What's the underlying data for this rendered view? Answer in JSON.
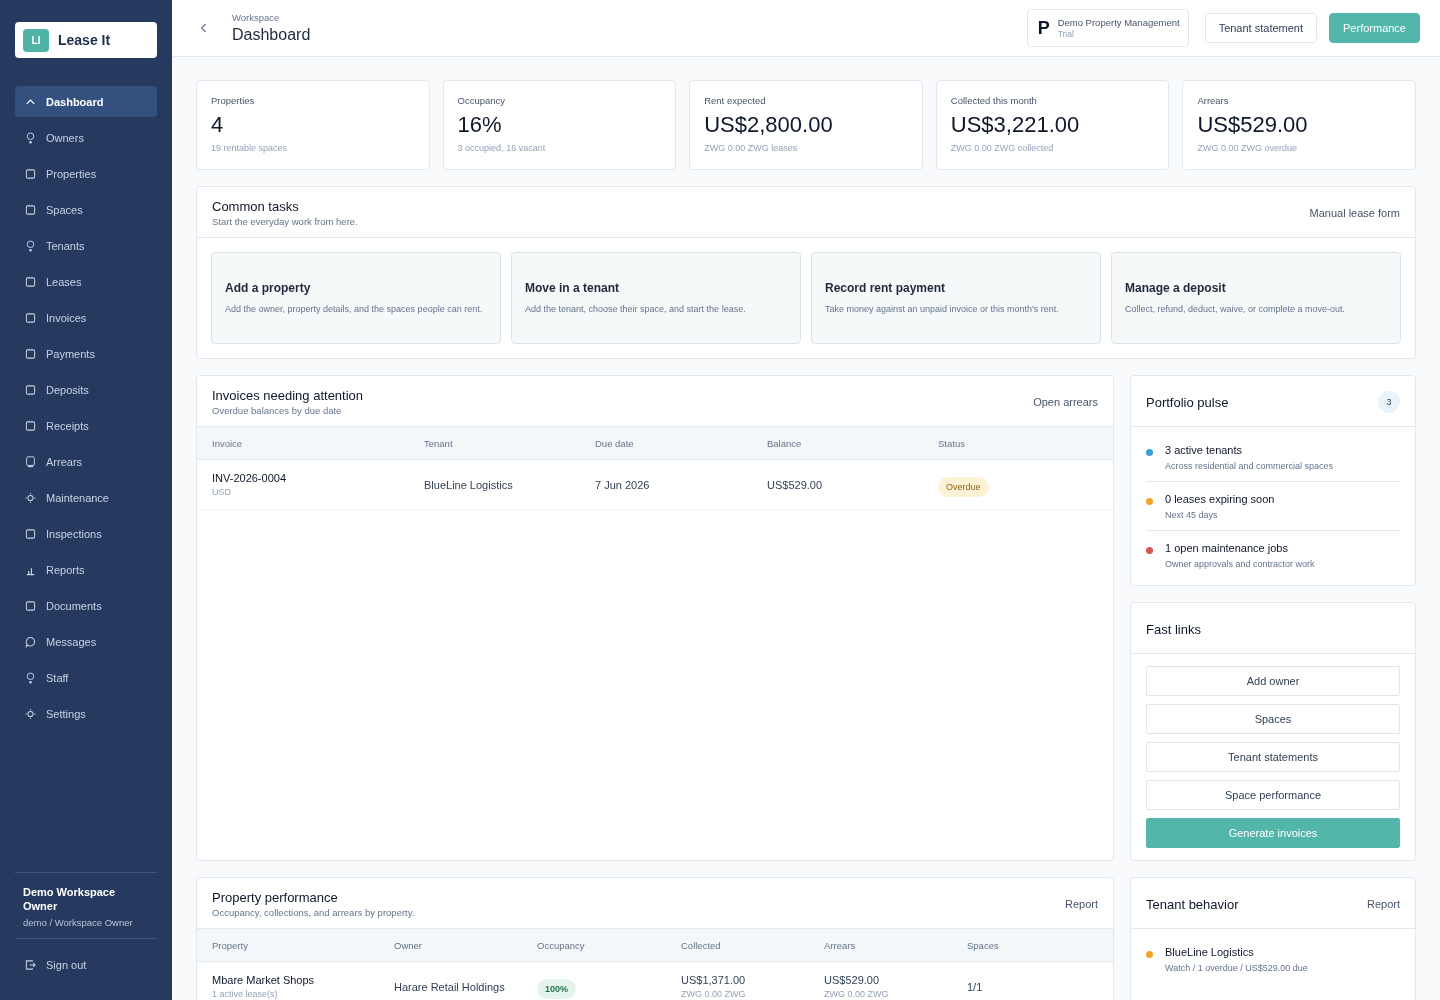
{
  "brand": {
    "logo": "LI",
    "name": "Lease It"
  },
  "nav": [
    {
      "label": "Dashboard",
      "selected": true
    },
    {
      "label": "Owners",
      "selected": false
    },
    {
      "label": "Properties",
      "selected": false
    },
    {
      "label": "Spaces",
      "selected": false
    },
    {
      "label": "Tenants",
      "selected": false
    },
    {
      "label": "Leases",
      "selected": false
    },
    {
      "label": "Invoices",
      "selected": false
    },
    {
      "label": "Payments",
      "selected": false
    },
    {
      "label": "Deposits",
      "selected": false
    },
    {
      "label": "Receipts",
      "selected": false
    },
    {
      "label": "Arrears",
      "selected": false
    },
    {
      "label": "Maintenance",
      "selected": false
    },
    {
      "label": "Inspections",
      "selected": false
    },
    {
      "label": "Reports",
      "selected": false
    },
    {
      "label": "Documents",
      "selected": false
    },
    {
      "label": "Messages",
      "selected": false
    },
    {
      "label": "Staff",
      "selected": false
    },
    {
      "label": "Settings",
      "selected": false
    }
  ],
  "user": {
    "name": "Demo Workspace Owner",
    "role": "demo / Workspace Owner"
  },
  "sign_out": "Sign out",
  "header": {
    "breadcrumb": "Workspace",
    "title": "Dashboard",
    "org_initial": "P",
    "org_name": "Demo Property Management",
    "org_plan": "Trial",
    "buttons": [
      "Tenant statement",
      "Performance"
    ]
  },
  "stats": [
    {
      "label": "Properties",
      "value": "4",
      "note": "19 rentable spaces"
    },
    {
      "label": "Occupancy",
      "value": "16%",
      "note": "3 occupied, 16 vacant"
    },
    {
      "label": "Rent expected",
      "value": "US$2,800.00",
      "note": "ZWG 0.00 ZWG leases"
    },
    {
      "label": "Collected this month",
      "value": "US$3,221.00",
      "note": "ZWG 0.00 ZWG collected"
    },
    {
      "label": "Arrears",
      "value": "US$529.00",
      "note": "ZWG 0.00 ZWG overdue"
    }
  ],
  "common_tasks": {
    "title": "Common tasks",
    "subtitle": "Start the everyday work from here.",
    "link": "Manual lease form",
    "tasks": [
      {
        "title": "Add a property",
        "text": "Add the owner, property details, and the spaces people can rent."
      },
      {
        "title": "Move in a tenant",
        "text": "Add the tenant, choose their space, and start the lease."
      },
      {
        "title": "Record rent payment",
        "text": "Take money against an unpaid invoice or this month's rent."
      },
      {
        "title": "Manage a deposit",
        "text": "Collect, refund, deduct, waive, or complete a move-out."
      }
    ]
  },
  "invoices": {
    "title": "Invoices needing attention",
    "subtitle": "Overdue balances by due date",
    "link": "Open arrears",
    "columns": [
      "Invoice",
      "Tenant",
      "Due date",
      "Balance",
      "Status"
    ],
    "rows": [
      {
        "invoice": "INV-2026-0004",
        "currency": "USD",
        "tenant": "BlueLine Logistics",
        "due": "7 Jun 2026",
        "balance": "US$529.00",
        "status": "Overdue"
      }
    ]
  },
  "portfolio_pulse": {
    "title": "Portfolio pulse",
    "count": "3",
    "items": [
      {
        "title": "3 active tenants",
        "text": "Across residential and commercial spaces",
        "color": "#3b9ede"
      },
      {
        "title": "0 leases expiring soon",
        "text": "Next 45 days",
        "color": "#f2a428"
      },
      {
        "title": "1 open maintenance jobs",
        "text": "Owner approvals and contractor work",
        "color": "#d9534f"
      }
    ]
  },
  "fast_links": {
    "title": "Fast links",
    "links": [
      {
        "label": "Add owner",
        "kind": "outline"
      },
      {
        "label": "Spaces",
        "kind": "outline"
      },
      {
        "label": "Tenant statements",
        "kind": "outline"
      },
      {
        "label": "Space performance",
        "kind": "outline"
      },
      {
        "label": "Generate invoices",
        "kind": "primary"
      }
    ]
  },
  "property_performance": {
    "title": "Property performance",
    "subtitle": "Occupancy, collections, and arrears by property.",
    "link": "Report",
    "columns": [
      "Property",
      "Owner",
      "Occupancy",
      "Collected",
      "Arrears",
      "Spaces"
    ],
    "rows": [
      {
        "property": "Mbare Market Shops",
        "leases": "1 active lease(s)",
        "owner": "Harare Retail Holdings",
        "occupancy": "100%",
        "collected": "US$1,371.00",
        "collected_zwg": "ZWG 0.00 ZWG",
        "arrears": "US$529.00",
        "arrears_zwg": "ZWG 0.00 ZWG",
        "spaces": "1/1"
      }
    ]
  },
  "tenant_behavior": {
    "title": "Tenant behavior",
    "link": "Report",
    "items": [
      {
        "name": "BlueLine Logistics",
        "text": "Watch / 1 overdue / US$529.00 due",
        "color": "#f2a428"
      }
    ]
  }
}
